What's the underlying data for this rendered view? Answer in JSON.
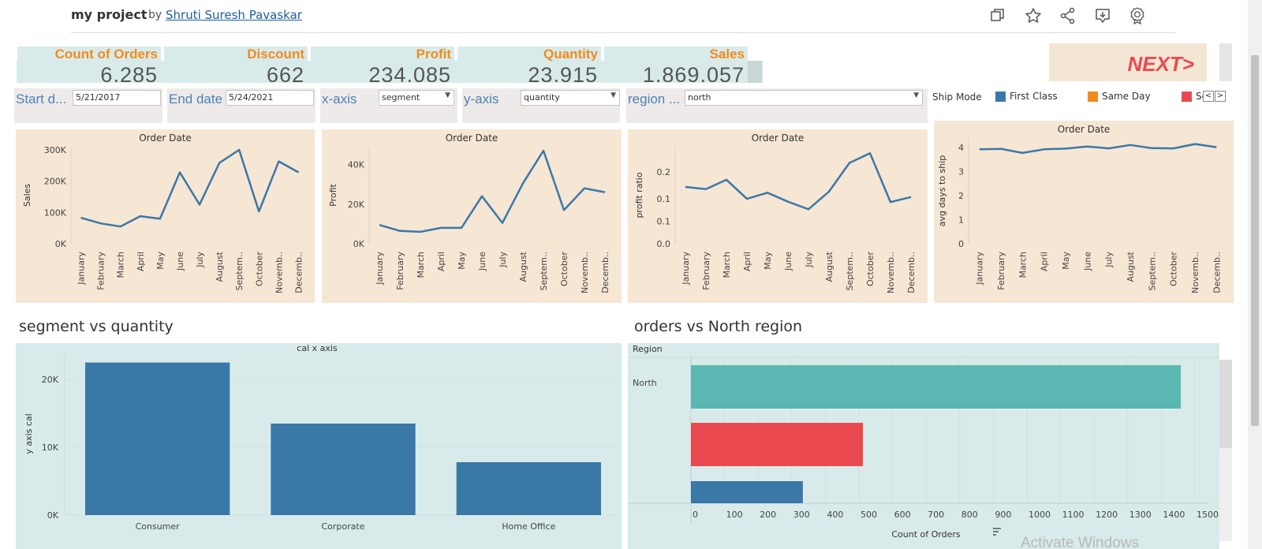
{
  "header": {
    "project_title": "my project",
    "by_text": "by",
    "author": "Shruti Suresh Pavaskar",
    "icons": [
      "copy-icon",
      "star-icon",
      "share-icon",
      "download-icon",
      "badge-icon"
    ]
  },
  "kpis": [
    {
      "label": "Count of Orders",
      "value": "6,285"
    },
    {
      "label": "Discount",
      "value": "662"
    },
    {
      "label": "Profit",
      "value": "234,085"
    },
    {
      "label": "Quantity",
      "value": "23,915"
    },
    {
      "label": "Sales",
      "value": "1,869,057"
    }
  ],
  "next_button": "NEXT>",
  "filters": {
    "start_label": "Start d...",
    "start_value": "5/21/2017",
    "end_label": "End date",
    "end_value": "5/24/2021",
    "xaxis_label": "x-axis",
    "xaxis_value": "segment",
    "yaxis_label": "y-axis",
    "yaxis_value": "quantity",
    "region_label": "region ...",
    "region_value": "north"
  },
  "legend": {
    "title": "Ship Mode",
    "items": [
      {
        "label": "First Class",
        "color": "#3a78a7"
      },
      {
        "label": "Same Day",
        "color": "#f28a1a"
      },
      {
        "label": "Se",
        "color": "#ea4a4f"
      }
    ],
    "nav_prev": "<",
    "nav_next": ">"
  },
  "chart_data": [
    {
      "type": "line",
      "title": "Order Date",
      "ylabel": "Sales",
      "x": [
        "January",
        "February",
        "March",
        "April",
        "May",
        "June",
        "July",
        "August",
        "Septem..",
        "October",
        "Novemb..",
        "Decemb.."
      ],
      "values": [
        83000,
        65000,
        55000,
        88000,
        80000,
        228000,
        125000,
        258000,
        300000,
        103000,
        263000,
        228000
      ],
      "ylim": [
        0,
        310000
      ],
      "yticks": [
        0,
        100000,
        200000,
        300000
      ],
      "ytick_labels": [
        "0K",
        "100K",
        "200K",
        "300K"
      ],
      "color": "#3a78a7"
    },
    {
      "type": "line",
      "title": "Order Date",
      "ylabel": "Profit",
      "x": [
        "January",
        "February",
        "March",
        "April",
        "May",
        "June",
        "July",
        "August",
        "Septem..",
        "October",
        "Novemb..",
        "Decemb.."
      ],
      "values": [
        9500,
        6500,
        6000,
        8000,
        8000,
        24000,
        10500,
        30500,
        47000,
        17000,
        28000,
        26000
      ],
      "ylim": [
        0,
        49000
      ],
      "yticks": [
        0,
        20000,
        40000
      ],
      "ytick_labels": [
        "0K",
        "20K",
        "40K"
      ],
      "color": "#3a78a7"
    },
    {
      "type": "line",
      "title": "Order Date",
      "ylabel": "profit ratio",
      "x": [
        "January",
        "February",
        "March",
        "April",
        "May",
        "June",
        "July",
        "August",
        "Septem..",
        "October",
        "Novemb..",
        "Decemb.."
      ],
      "values": [
        0.158,
        0.152,
        0.178,
        0.125,
        0.142,
        0.117,
        0.096,
        0.145,
        0.225,
        0.252,
        0.116,
        0.13
      ],
      "ylim": [
        0,
        0.27
      ],
      "yticks": [
        0.0,
        0.063,
        0.125,
        0.2
      ],
      "ytick_labels": [
        "0.0",
        "0.1",
        "0.1",
        "0.2"
      ],
      "color": "#3a78a7"
    },
    {
      "type": "line",
      "title": "Order Date",
      "ylabel": "avg days to ship",
      "x": [
        "January",
        "February",
        "March",
        "April",
        "May",
        "June",
        "July",
        "August",
        "Septem..",
        "October",
        "Novemb..",
        "Decemb.."
      ],
      "values": [
        3.93,
        3.95,
        3.78,
        3.93,
        3.96,
        4.05,
        3.97,
        4.11,
        3.98,
        3.97,
        4.15,
        4.02
      ],
      "ylim": [
        0,
        4.4
      ],
      "yticks": [
        0,
        1,
        2,
        3,
        4
      ],
      "ytick_labels": [
        "0",
        "1",
        "2",
        "3",
        "4"
      ],
      "color": "#3a78a7"
    },
    {
      "type": "bar",
      "section_title": "segment vs quantity",
      "title": "cal x axis",
      "ylabel": "y axis cal",
      "categories": [
        "Consumer",
        "Corporate",
        "Home Office"
      ],
      "values": [
        22500,
        13500,
        7800
      ],
      "ylim": [
        0,
        23500
      ],
      "yticks": [
        0,
        10000,
        20000
      ],
      "ytick_labels": [
        "0K",
        "10K",
        "20K"
      ],
      "color": "#3a78a7"
    },
    {
      "type": "bar",
      "orientation": "horizontal",
      "section_title": "orders vs North  region",
      "row_header": "Region",
      "row_label": "North",
      "xlabel": "Count of Orders",
      "series": [
        {
          "value": 1458,
          "color": "#5ab7b2"
        },
        {
          "value": 512,
          "color": "#ea4a4f"
        },
        {
          "value": 333,
          "color": "#3a78a7"
        }
      ],
      "xlim": [
        0,
        1540
      ],
      "xticks": [
        0,
        100,
        200,
        300,
        400,
        500,
        600,
        700,
        800,
        900,
        1000,
        1100,
        1200,
        1300,
        1400,
        1500
      ]
    }
  ],
  "watermark": "Activate Windows"
}
